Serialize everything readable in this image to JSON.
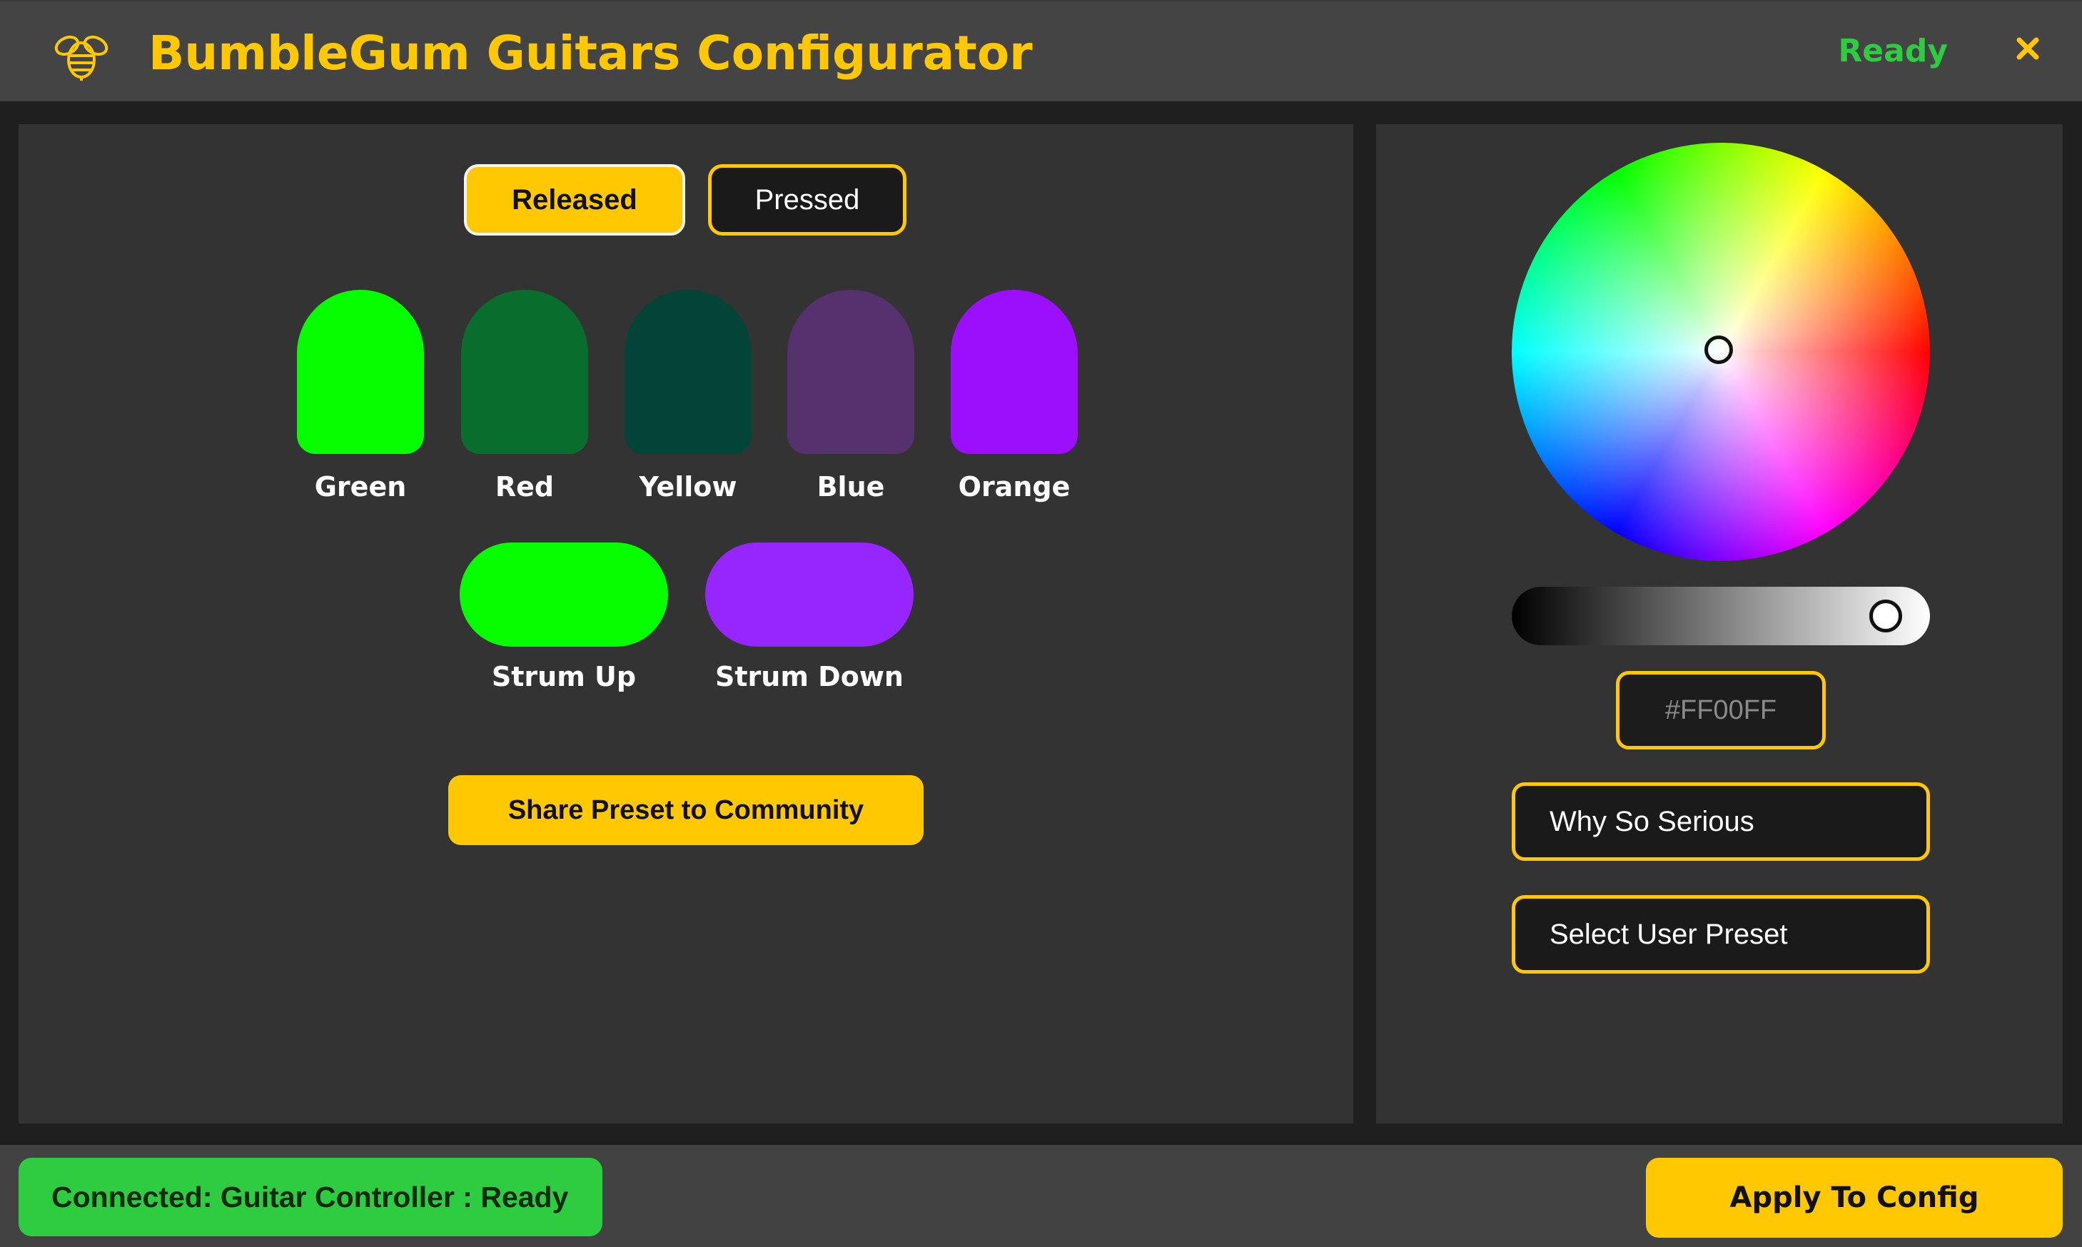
{
  "header": {
    "title": "BumbleGum Guitars Configurator",
    "status": "Ready",
    "logo_icon": "bee-icon",
    "close_icon": "close-icon",
    "brand_color": "#FFC800",
    "status_color": "#2ECC40"
  },
  "modes": {
    "selected": "Released",
    "items": [
      {
        "label": "Released"
      },
      {
        "label": "Pressed"
      }
    ]
  },
  "frets": [
    {
      "label": "Green",
      "color": "#06FF00"
    },
    {
      "label": "Red",
      "color": "#096E2D"
    },
    {
      "label": "Yellow",
      "color": "#024537"
    },
    {
      "label": "Blue",
      "color": "#55316D"
    },
    {
      "label": "Orange",
      "color": "#9B0FFD"
    }
  ],
  "strums": [
    {
      "label": "Strum Up",
      "color": "#06FF00"
    },
    {
      "label": "Strum Down",
      "color": "#9726FE"
    }
  ],
  "share_button": "Share Preset to Community",
  "color_picker": {
    "brightness": 0.94,
    "hex_placeholder": "#FF00FF"
  },
  "presets": {
    "builtin_selected": "Why So Serious",
    "user_placeholder": "Select User Preset"
  },
  "footer": {
    "connection_status": "Connected: Guitar Controller : Ready",
    "apply_button": "Apply To Config"
  }
}
